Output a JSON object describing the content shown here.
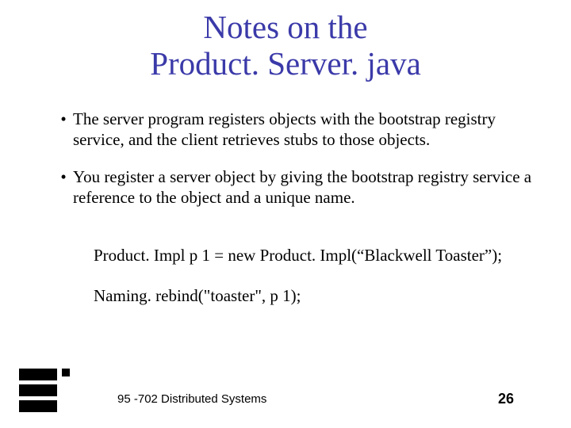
{
  "title_line1": "Notes on the",
  "title_line2": "Product. Server. java",
  "bullets": [
    "The server program registers objects with the bootstrap registry service, and the client retrieves stubs to those objects.",
    "You register a server object by giving the bootstrap registry service a reference to the object and a unique name."
  ],
  "code_line1": "Product. Impl p 1 = new Product. Impl(“Blackwell Toaster”);",
  "code_line2": "Naming. rebind(\"toaster\", p 1);",
  "footer": "95 -702 Distributed Systems",
  "page": "26"
}
